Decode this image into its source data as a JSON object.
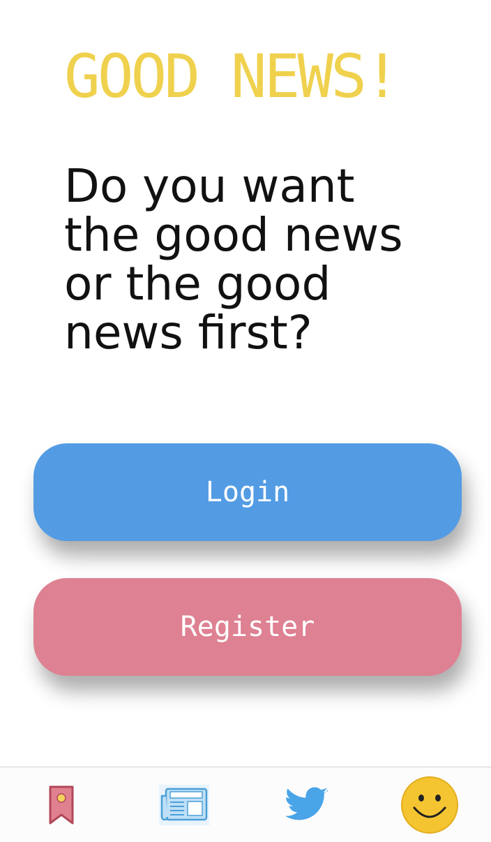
{
  "header": {
    "title": "GOOD NEWS!"
  },
  "tagline": {
    "lines": [
      "Do you want",
      "the good news",
      "or the good",
      "news first?"
    ]
  },
  "actions": {
    "login_label": "Login",
    "register_label": "Register"
  },
  "tabbar": {
    "items": [
      {
        "icon": "bookmark-icon"
      },
      {
        "icon": "newspaper-icon"
      },
      {
        "icon": "twitter-bird-icon"
      },
      {
        "icon": "smiley-face-icon"
      }
    ]
  },
  "colors": {
    "title": "#efd14e",
    "login": "#539ce4",
    "register": "#de8192",
    "twitter": "#4aa4e8",
    "smiley": "#f5c531"
  }
}
